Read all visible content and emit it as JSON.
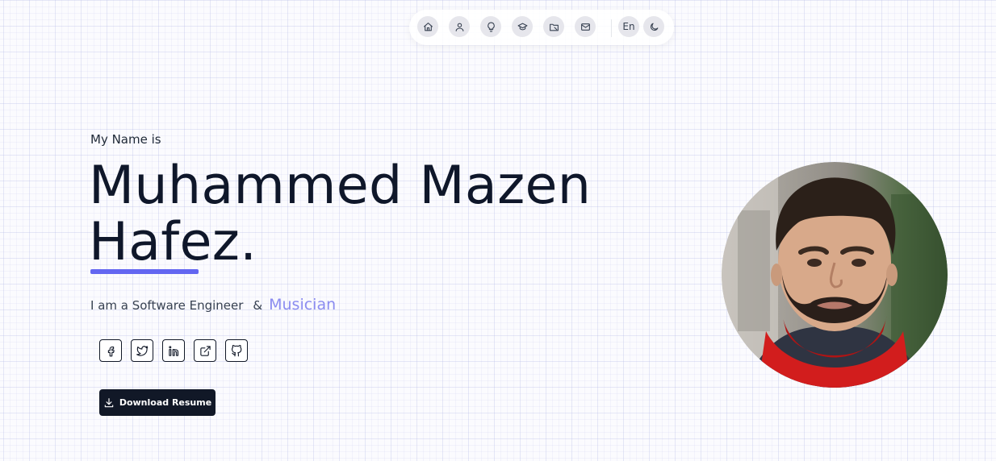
{
  "nav": {
    "items": [
      {
        "icon": "home-icon"
      },
      {
        "icon": "user-icon"
      },
      {
        "icon": "lightbulb-icon"
      },
      {
        "icon": "graduation-cap-icon"
      },
      {
        "icon": "folder-icon"
      },
      {
        "icon": "mail-icon"
      }
    ],
    "language_label": "En",
    "theme_icon": "moon-icon"
  },
  "hero": {
    "intro": "My Name is",
    "name_line1": "Muhammed Mazen",
    "name_line2": "Hafez.",
    "role_prefix": "I am a Software Engineer",
    "role_amp": "&",
    "role_accent": "Musician",
    "accent_color": "#6366f1"
  },
  "social": [
    {
      "icon": "facebook-icon"
    },
    {
      "icon": "twitter-icon"
    },
    {
      "icon": "linkedin-icon"
    },
    {
      "icon": "external-link-icon"
    },
    {
      "icon": "github-icon"
    }
  ],
  "download_button": {
    "label": "Download Resume",
    "icon": "download-icon"
  },
  "avatar": {
    "alt": "profile photo"
  }
}
